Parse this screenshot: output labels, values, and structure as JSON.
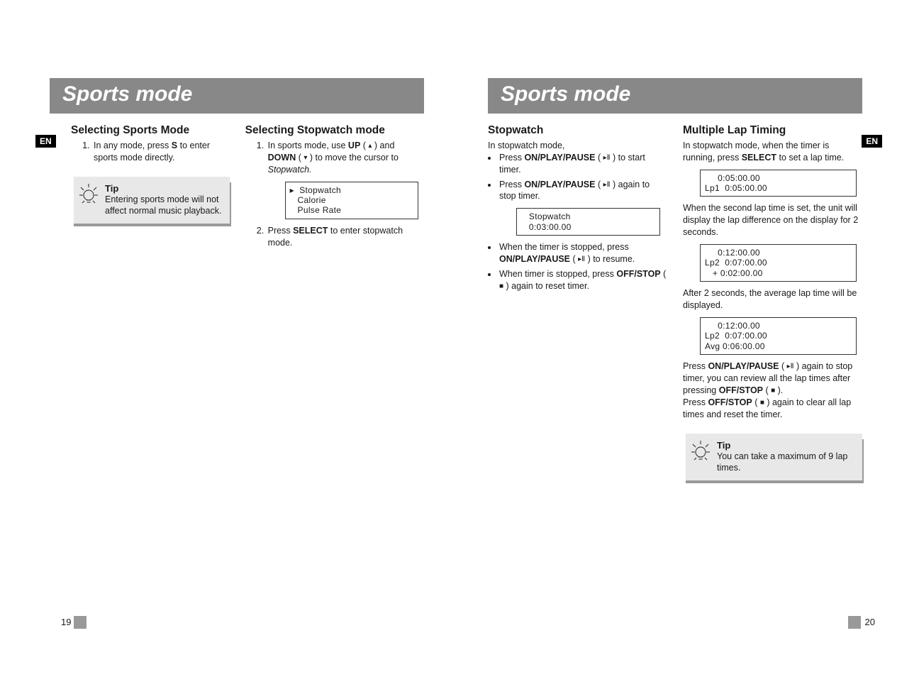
{
  "left_page": {
    "title": "Sports mode",
    "lang_tag": "EN",
    "col1": {
      "heading": "Selecting Sports Mode",
      "step1_pre": "In any mode, press ",
      "step1_key": "S",
      "step1_post": " to enter sports mode directly.",
      "tip_title": "Tip",
      "tip_text": "Entering sports mode will not affect normal music playback."
    },
    "col2": {
      "heading": "Selecting Stopwatch mode",
      "s1a": "In sports mode, use ",
      "s1_up": "UP",
      "s1b": " ( ",
      "s1c": " ) and ",
      "s1_down": "DOWN",
      "s1d": " ( ",
      "s1e": " ) to move the cursor to ",
      "s1_target": "Stopwatch.",
      "lcd": "▸  Stopwatch\n   Calorie\n   Pulse Rate",
      "s2a": "Press ",
      "s2_key": "SELECT",
      "s2b": " to enter stopwatch mode."
    },
    "page_number": "19"
  },
  "right_page": {
    "title": "Sports mode",
    "lang_tag": "EN",
    "col1": {
      "heading": "Stopwatch",
      "intro": "In stopwatch mode,",
      "b1a": "Press ",
      "b1_key": "ON/PLAY/PAUSE",
      "b1b": " ( ",
      "b1c": " ) to start timer.",
      "b2a": "Press ",
      "b2_key": "ON/PLAY/PAUSE",
      "b2b": " ( ",
      "b2c": " ) again to stop timer.",
      "lcd1": "   Stopwatch\n   0:03:00.00",
      "b3a": "When the timer is stopped, press ",
      "b3_key": "ON/PLAY/PAUSE",
      "b3b": " ( ",
      "b3c": " ) to resume.",
      "b4a": "When timer is stopped, press ",
      "b4_key": "OFF/STOP",
      "b4b": " ( ",
      "b4c": " ) again to reset timer."
    },
    "col2": {
      "heading": "Multiple Lap Timing",
      "intro_a": "In stopwatch mode, when the timer is running, press ",
      "intro_key": "SELECT",
      "intro_b": " to set a lap time.",
      "lcd1": "     0:05:00.00\nLp1  0:05:00.00",
      "para2": "When the second lap time is set, the unit will display the lap difference on the display for 2 seconds.",
      "lcd2": "     0:12:00.00\nLp2  0:07:00.00\n   + 0:02:00.00",
      "para3": "After 2 seconds, the average lap time will be displayed.",
      "lcd3": "     0:12:00.00\nLp2  0:07:00.00\nAvg 0:06:00.00",
      "p4a": "Press ",
      "p4k1": "ON/PLAY/PAUSE",
      "p4b": " ( ",
      "p4c": " ) again to stop timer, you can review all the lap times after pressing ",
      "p4k2": "OFF/STOP",
      "p4d": " ( ",
      "p4e": " ).",
      "p5a": "Press ",
      "p5k": "OFF/STOP",
      "p5b": " ( ",
      "p5c": " ) again to clear all lap times and reset the timer.",
      "tip_title": "Tip",
      "tip_text": "You can take a maximum of 9 lap times."
    },
    "page_number": "20"
  },
  "glyphs": {
    "up": "▴",
    "down": "▾",
    "playpause": "▸Ⅱ",
    "stop": "■"
  }
}
